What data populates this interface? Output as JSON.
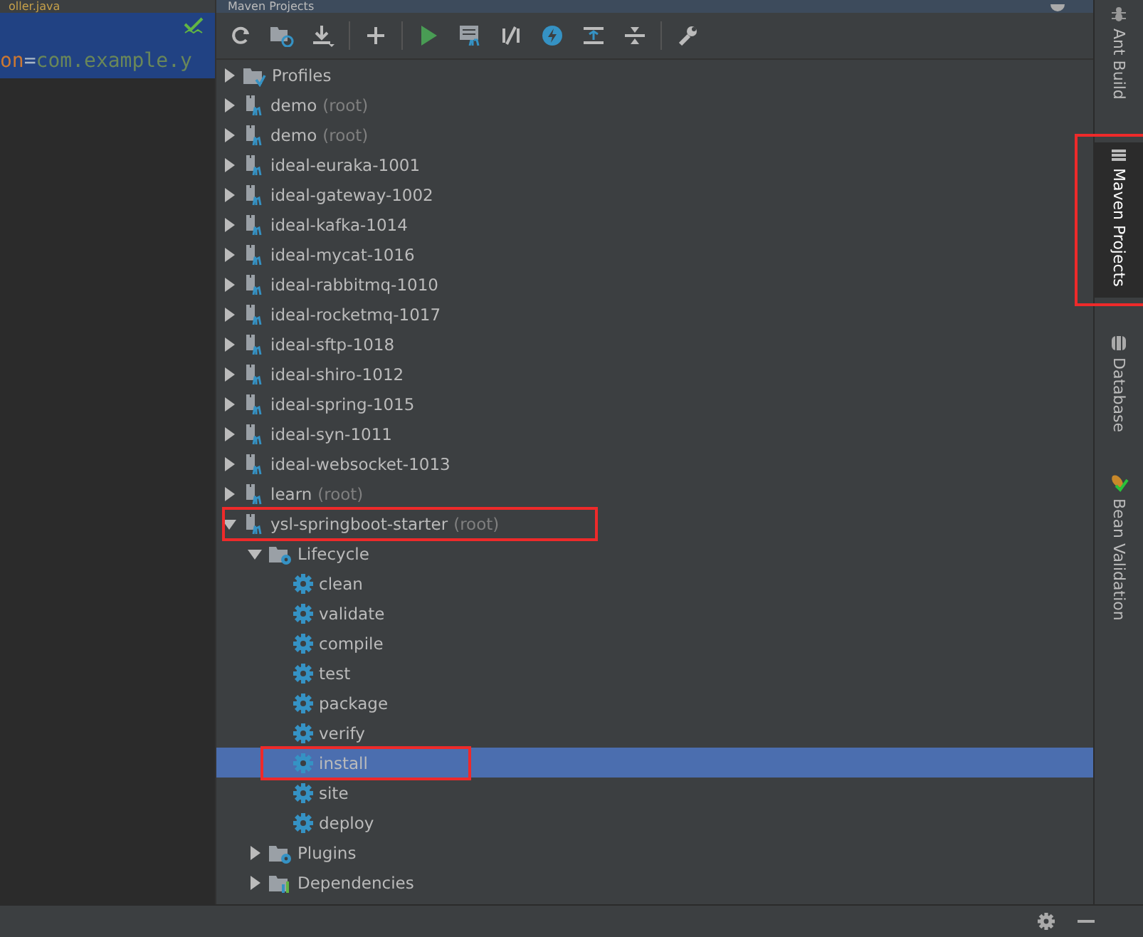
{
  "editor": {
    "tab": "oller.java",
    "code_line": {
      "key": "on",
      "op": "=",
      "value": "com.example.y"
    }
  },
  "maven_panel": {
    "title": "Maven Projects",
    "tree": [
      {
        "kind": "profiles",
        "label": "Profiles",
        "expanded": false,
        "selected": false
      },
      {
        "kind": "module",
        "label": "demo",
        "note": "(root)",
        "expanded": false,
        "selected": false
      },
      {
        "kind": "module",
        "label": "demo",
        "note": "(root)",
        "expanded": false,
        "selected": false
      },
      {
        "kind": "module",
        "label": "ideal-euraka-1001",
        "expanded": false,
        "selected": false
      },
      {
        "kind": "module",
        "label": "ideal-gateway-1002",
        "expanded": false,
        "selected": false
      },
      {
        "kind": "module",
        "label": "ideal-kafka-1014",
        "expanded": false,
        "selected": false
      },
      {
        "kind": "module",
        "label": "ideal-mycat-1016",
        "expanded": false,
        "selected": false
      },
      {
        "kind": "module",
        "label": "ideal-rabbitmq-1010",
        "expanded": false,
        "selected": false
      },
      {
        "kind": "module",
        "label": "ideal-rocketmq-1017",
        "expanded": false,
        "selected": false
      },
      {
        "kind": "module",
        "label": "ideal-sftp-1018",
        "expanded": false,
        "selected": false
      },
      {
        "kind": "module",
        "label": "ideal-shiro-1012",
        "expanded": false,
        "selected": false
      },
      {
        "kind": "module",
        "label": "ideal-spring-1015",
        "expanded": false,
        "selected": false
      },
      {
        "kind": "module",
        "label": "ideal-syn-1011",
        "expanded": false,
        "selected": false
      },
      {
        "kind": "module",
        "label": "ideal-websocket-1013",
        "expanded": false,
        "selected": false
      },
      {
        "kind": "module",
        "label": "learn",
        "note": "(root)",
        "expanded": false,
        "selected": false
      },
      {
        "kind": "module",
        "label": "ysl-springboot-starter",
        "note": "(root)",
        "expanded": true,
        "selected": false,
        "highlighted": true,
        "children": [
          {
            "kind": "lifecycle",
            "label": "Lifecycle",
            "expanded": true,
            "selected": false,
            "children": [
              {
                "kind": "goal",
                "label": "clean",
                "selected": false
              },
              {
                "kind": "goal",
                "label": "validate",
                "selected": false
              },
              {
                "kind": "goal",
                "label": "compile",
                "selected": false
              },
              {
                "kind": "goal",
                "label": "test",
                "selected": false
              },
              {
                "kind": "goal",
                "label": "package",
                "selected": false
              },
              {
                "kind": "goal",
                "label": "verify",
                "selected": false
              },
              {
                "kind": "goal",
                "label": "install",
                "selected": true,
                "highlighted": true
              },
              {
                "kind": "goal",
                "label": "site",
                "selected": false
              },
              {
                "kind": "goal",
                "label": "deploy",
                "selected": false
              }
            ]
          },
          {
            "kind": "plugins",
            "label": "Plugins",
            "expanded": false,
            "selected": false
          },
          {
            "kind": "dependencies",
            "label": "Dependencies",
            "expanded": false,
            "selected": false
          }
        ]
      }
    ]
  },
  "side_tabs": [
    {
      "label": "Ant Build",
      "selected": false
    },
    {
      "label": "Maven Projects",
      "selected": true,
      "highlighted": true
    },
    {
      "label": "Database",
      "selected": false
    },
    {
      "label": "Bean Validation",
      "selected": false
    }
  ]
}
